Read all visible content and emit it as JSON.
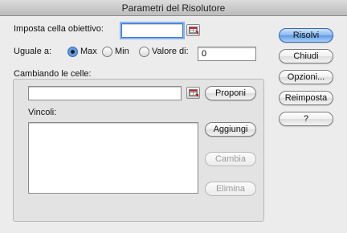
{
  "window": {
    "title": "Parametri del Risolutore"
  },
  "target": {
    "label": "Imposta cella obiettivo:",
    "value": ""
  },
  "equal_to": {
    "label": "Uguale a:",
    "options": [
      {
        "label": "Max",
        "selected": true
      },
      {
        "label": "Min",
        "selected": false
      },
      {
        "label": "Valore di:",
        "selected": false
      }
    ],
    "value_of": "0"
  },
  "changing": {
    "label": "Cambiando le celle:",
    "value": "",
    "guess_label": "Proponi"
  },
  "constraints": {
    "label": "Vincoli:",
    "items": [],
    "add_label": "Aggiungi",
    "change_label": "Cambia",
    "delete_label": "Elimina"
  },
  "actions": {
    "solve": "Risolvi",
    "close": "Chiudi",
    "options": "Opzioni...",
    "reset": "Reimposta",
    "help": "?"
  },
  "colors": {
    "default_button": "#6ea5ea",
    "title_bar": "#cfcfcf",
    "focus_ring": "#86b3ee"
  }
}
